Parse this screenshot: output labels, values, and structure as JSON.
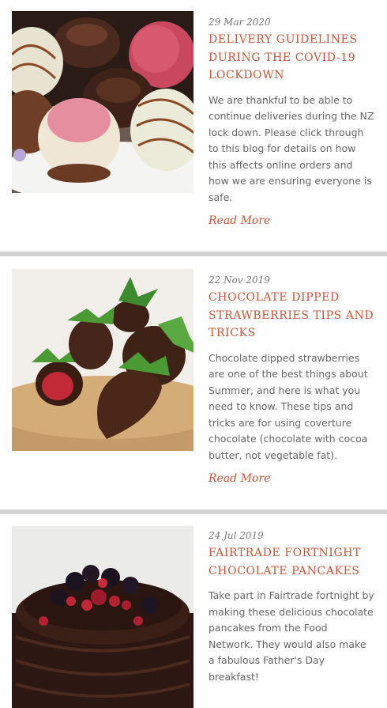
{
  "posts": [
    {
      "date": "29 Mar 2020",
      "title": "Delivery Guidelines during the COVID-19 lockdown",
      "excerpt": "We are thankful to be able to continue deliveries during the NZ lock down. Please click through to this blog for details on how this affects online orders and how we are ensuring everyone is safe.",
      "read_more": "Read More"
    },
    {
      "date": "22 Nov 2019",
      "title": "Chocolate Dipped Strawberries Tips and Tricks",
      "excerpt": "Chocolate dipped strawberries are one of the best things about Summer, and here is what you need to know. These tips and tricks are for using coverture chocolate (chocolate with cocoa butter, not vegetable fat).",
      "read_more": "Read More"
    },
    {
      "date": "24 Jul 2019",
      "title": "Fairtrade Fortnight Chocolate Pancakes",
      "excerpt": "Take part in Fairtrade fortnight by making these delicious chocolate pancakes from the Food Network. They would also make a fabulous Father's Day breakfast!",
      "read_more": ""
    }
  ],
  "colors": {
    "accent": "#c9553a",
    "date_text": "#777777",
    "body_text": "#666666",
    "divider": "#d3d3d3"
  }
}
